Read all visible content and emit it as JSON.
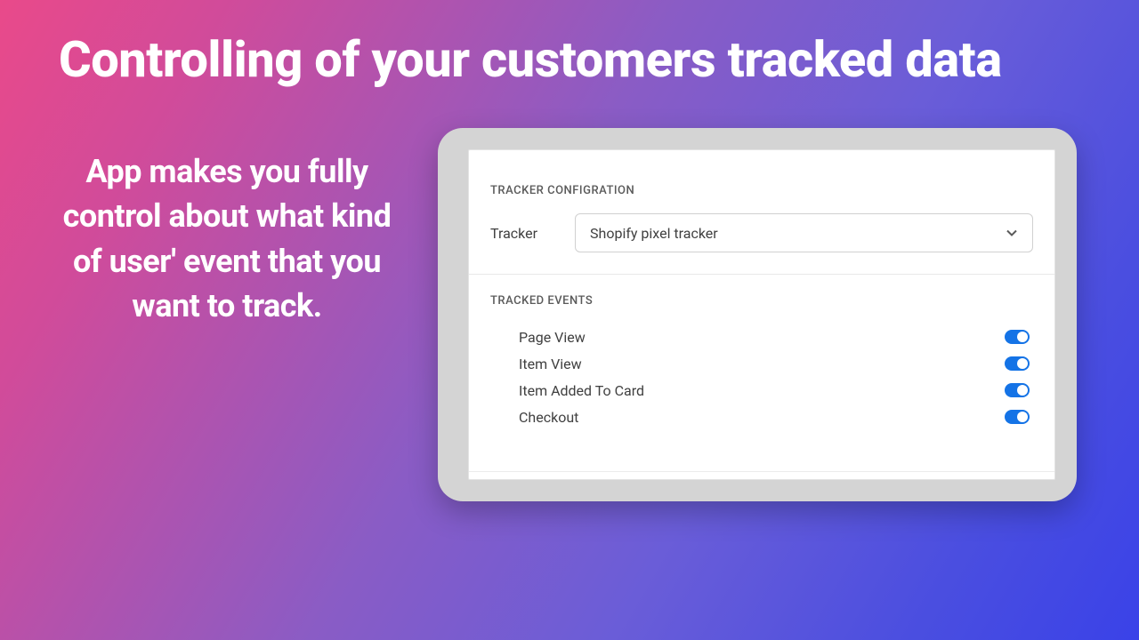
{
  "headline": "Controlling of your customers tracked data",
  "subtext": "App makes you fully control about what kind of user' event that you want to track.",
  "panel": {
    "config_heading": "TRACKER CONFIGRATION",
    "tracker_label": "Tracker",
    "tracker_selected": "Shopify pixel tracker",
    "events_heading": "TRACKED EVENTS",
    "events": [
      {
        "label": "Page View",
        "enabled": true
      },
      {
        "label": "Item View",
        "enabled": true
      },
      {
        "label": "Item Added To Card",
        "enabled": true
      },
      {
        "label": "Checkout",
        "enabled": true
      }
    ]
  }
}
